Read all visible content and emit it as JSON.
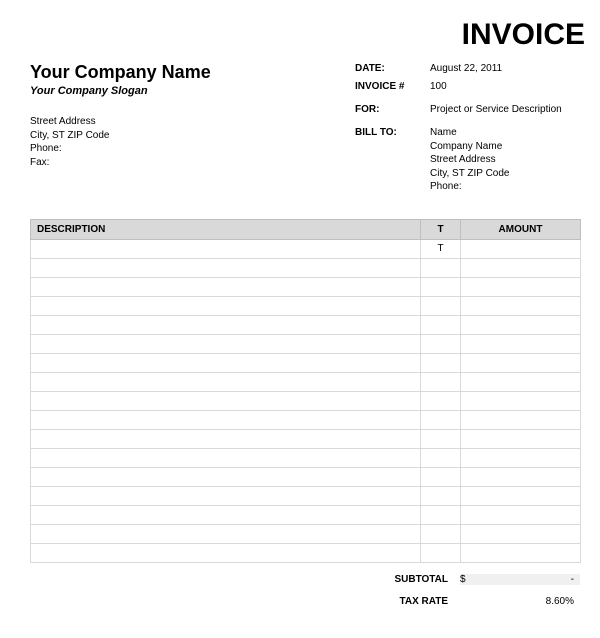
{
  "title": "INVOICE",
  "company": {
    "name": "Your Company Name",
    "slogan": "Your Company Slogan",
    "address1": "Street Address",
    "address2": "City, ST  ZIP Code",
    "phone_label": "Phone:",
    "fax_label": "Fax:"
  },
  "meta": {
    "date_label": "DATE:",
    "date_value": "August 22, 2011",
    "invoice_num_label": "INVOICE #",
    "invoice_num_value": "100",
    "for_label": "FOR:",
    "for_value": "Project or Service Description",
    "billto_label": "BILL TO:"
  },
  "billto": {
    "name": "Name",
    "company": "Company Name",
    "address1": "Street Address",
    "address2": "City, ST  ZIP Code",
    "phone_label": "Phone:"
  },
  "table": {
    "headers": {
      "description": "DESCRIPTION",
      "t": "T",
      "amount": "AMOUNT"
    },
    "rows": [
      {
        "description": "",
        "t": "T",
        "amount": ""
      },
      {
        "description": "",
        "t": "",
        "amount": ""
      },
      {
        "description": "",
        "t": "",
        "amount": ""
      },
      {
        "description": "",
        "t": "",
        "amount": ""
      },
      {
        "description": "",
        "t": "",
        "amount": ""
      },
      {
        "description": "",
        "t": "",
        "amount": ""
      },
      {
        "description": "",
        "t": "",
        "amount": ""
      },
      {
        "description": "",
        "t": "",
        "amount": ""
      },
      {
        "description": "",
        "t": "",
        "amount": ""
      },
      {
        "description": "",
        "t": "",
        "amount": ""
      },
      {
        "description": "",
        "t": "",
        "amount": ""
      },
      {
        "description": "",
        "t": "",
        "amount": ""
      },
      {
        "description": "",
        "t": "",
        "amount": ""
      },
      {
        "description": "",
        "t": "",
        "amount": ""
      },
      {
        "description": "",
        "t": "",
        "amount": ""
      },
      {
        "description": "",
        "t": "",
        "amount": ""
      },
      {
        "description": "",
        "t": "",
        "amount": ""
      }
    ]
  },
  "totals": {
    "subtotal_label": "SUBTOTAL",
    "subtotal_currency": "$",
    "subtotal_value": "-",
    "taxrate_label": "TAX RATE",
    "taxrate_value": "8.60%"
  }
}
